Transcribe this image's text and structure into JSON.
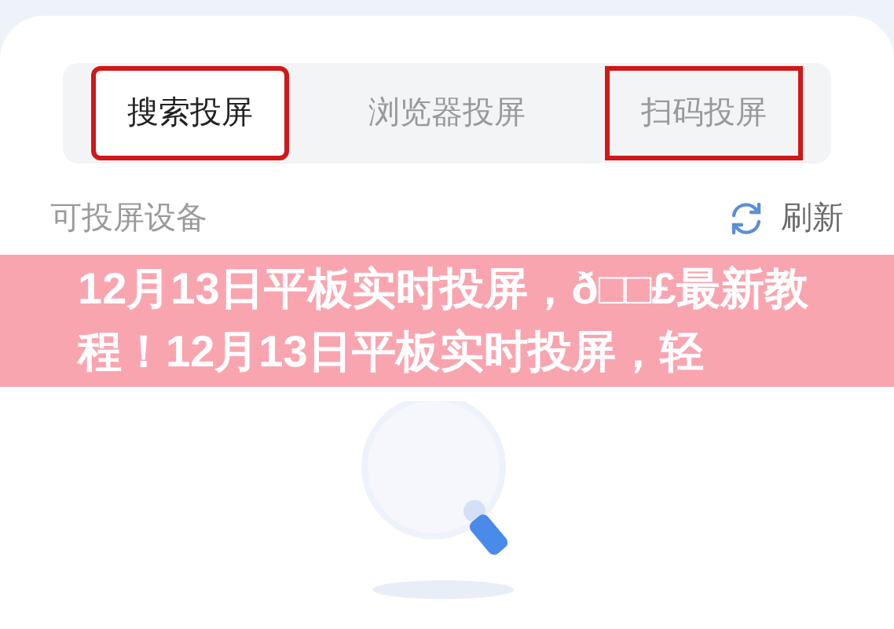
{
  "tabs": [
    {
      "label": "搜索投屏",
      "selected": true,
      "annotated": true
    },
    {
      "label": "浏览器投屏",
      "selected": false,
      "annotated": false
    },
    {
      "label": "扫码投屏",
      "selected": false,
      "annotated": true
    }
  ],
  "section": {
    "title": "可投屏设备",
    "action": "刷新"
  },
  "banner": {
    "title": "12月13日平板实时投屏，ð□□£最新教程！12月13日平板实时投屏，轻"
  }
}
